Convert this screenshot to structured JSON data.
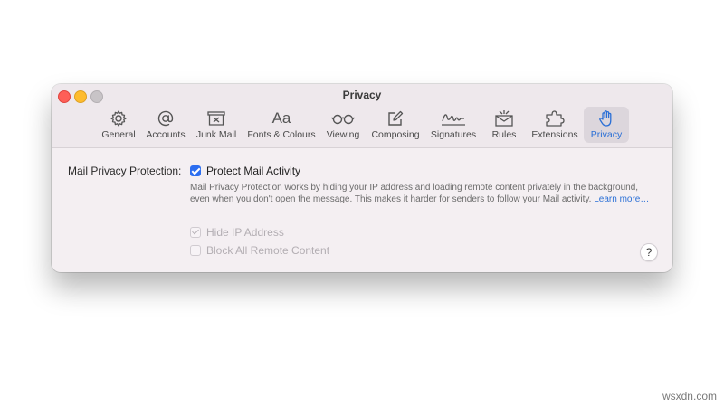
{
  "window": {
    "title": "Privacy"
  },
  "toolbar": {
    "tabs": [
      {
        "label": "General",
        "icon": "gear-icon"
      },
      {
        "label": "Accounts",
        "icon": "at-sign-icon"
      },
      {
        "label": "Junk Mail",
        "icon": "junk-tray-icon"
      },
      {
        "label": "Fonts & Colours",
        "icon": "font-aa-icon"
      },
      {
        "label": "Viewing",
        "icon": "glasses-icon"
      },
      {
        "label": "Composing",
        "icon": "compose-pencil-icon"
      },
      {
        "label": "Signatures",
        "icon": "signature-icon"
      },
      {
        "label": "Rules",
        "icon": "rules-envelope-icon"
      },
      {
        "label": "Extensions",
        "icon": "puzzle-icon"
      },
      {
        "label": "Privacy",
        "icon": "hand-icon",
        "active": true
      }
    ],
    "font_icon_text": "Aa",
    "accent_color": "#2a6fd6"
  },
  "privacy": {
    "section_label": "Mail Privacy Protection:",
    "protect_label": "Protect Mail Activity",
    "protect_checked": true,
    "description": "Mail Privacy Protection works by hiding your IP address and loading remote content privately in the background, even when you don't open the message. This makes it harder for senders to follow your Mail activity.",
    "learn_more": "Learn more…",
    "hide_ip_label": "Hide IP Address",
    "hide_ip_checked": true,
    "hide_ip_disabled": true,
    "block_remote_label": "Block All Remote Content",
    "block_remote_checked": false,
    "block_remote_disabled": true,
    "help_glyph": "?"
  },
  "watermark": "wsxdn.com"
}
